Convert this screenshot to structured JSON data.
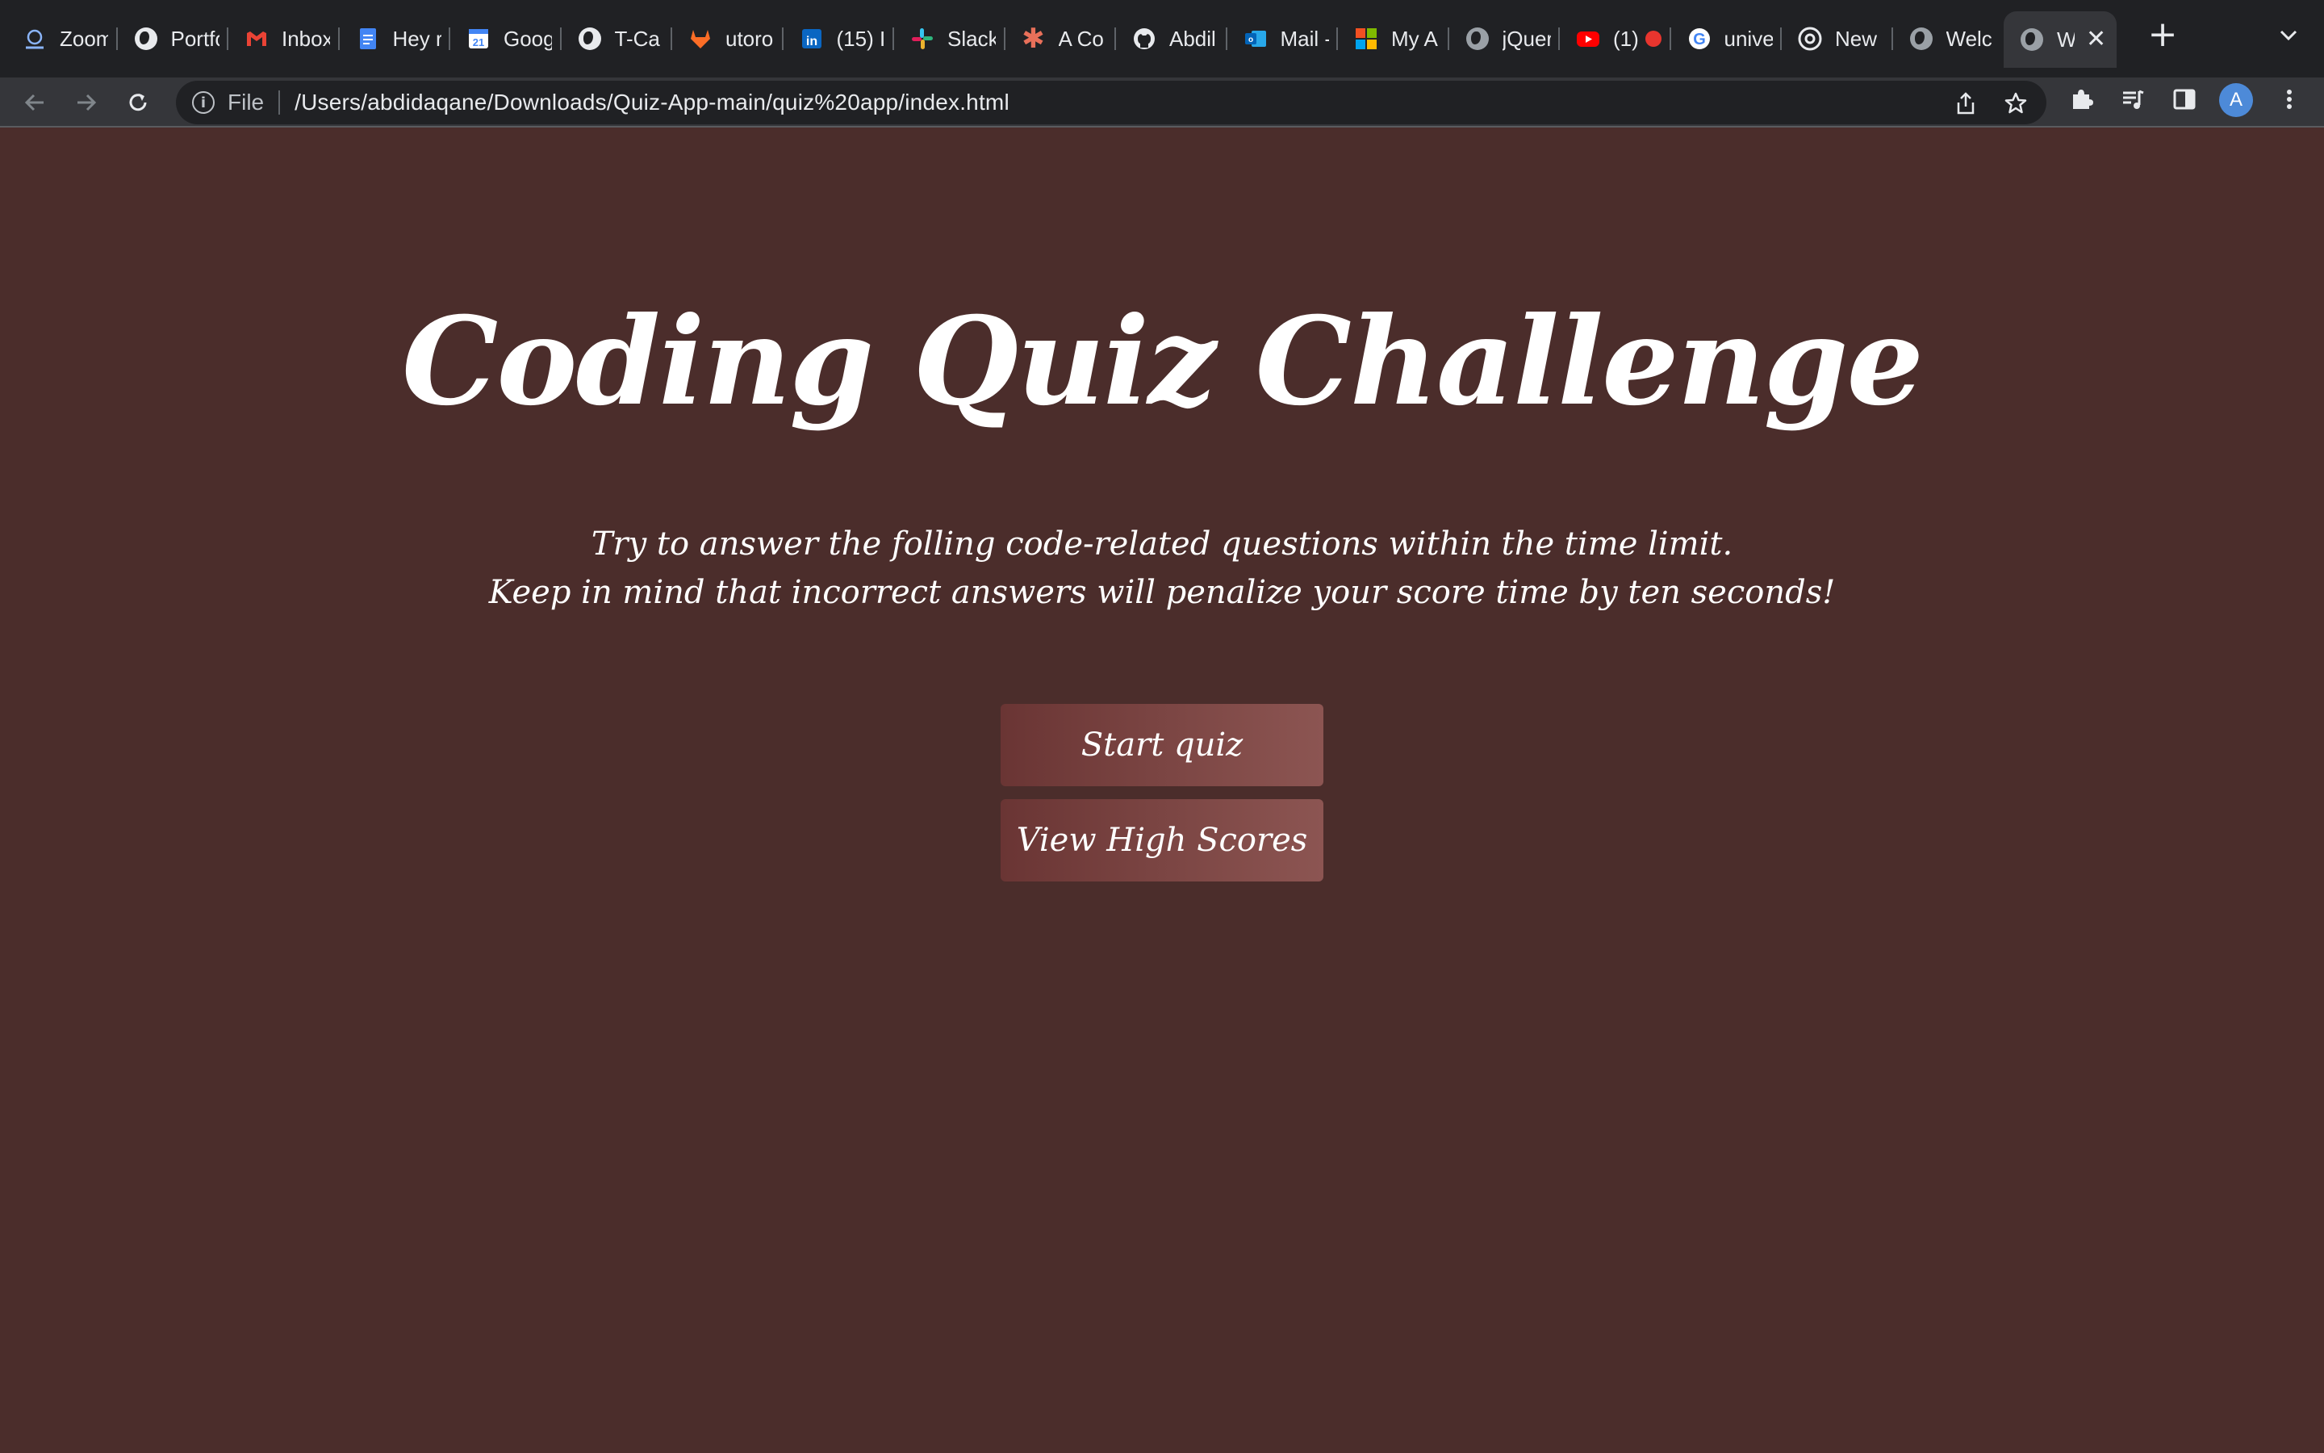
{
  "browser": {
    "tabs": [
      {
        "title": "Zoom",
        "icon": "zoom-icon"
      },
      {
        "title": "Portfolio",
        "icon": "globe-icon"
      },
      {
        "title": "Inbox",
        "icon": "gmail-icon"
      },
      {
        "title": "Hey r",
        "icon": "docs-icon"
      },
      {
        "title": "Google",
        "icon": "calendar-icon"
      },
      {
        "title": "T-Ca",
        "icon": "globe-icon"
      },
      {
        "title": "utoro",
        "icon": "gitlab-icon"
      },
      {
        "title": "(15) I",
        "icon": "linkedin-icon"
      },
      {
        "title": "Slack",
        "icon": "slack-icon"
      },
      {
        "title": "A Co",
        "icon": "asterisk-icon"
      },
      {
        "title": "Abdil",
        "icon": "github-icon"
      },
      {
        "title": "Mail -",
        "icon": "outlook-icon"
      },
      {
        "title": "My A",
        "icon": "microsoft-icon"
      },
      {
        "title": "jQuer",
        "icon": "globe-icon"
      },
      {
        "title": "(1)",
        "icon": "youtube-icon"
      },
      {
        "title": "unive",
        "icon": "google-icon"
      },
      {
        "title": "New",
        "icon": "chrome-icon"
      },
      {
        "title": "Welc",
        "icon": "globe-icon"
      },
      {
        "title": "W",
        "icon": "globe-icon",
        "active": true
      }
    ],
    "address": {
      "scheme_label": "File",
      "url": "/Users/abdidaqane/Downloads/Quiz-App-main/quiz%20app/index.html"
    },
    "profile_initial": "A"
  },
  "page": {
    "title": "Coding Quiz Challenge",
    "description_line1": "Try to answer the folling code-related questions within the time limit.",
    "description_line2": "Keep in mind that incorrect answers will penalize your score time by ten seconds!",
    "start_button": "Start quiz",
    "highscores_button": "View High Scores"
  },
  "colors": {
    "page_background": "#4b2d2b",
    "button_gradient_start": "#6a3534",
    "button_gradient_end": "#8c5552",
    "text": "#ffffff"
  }
}
